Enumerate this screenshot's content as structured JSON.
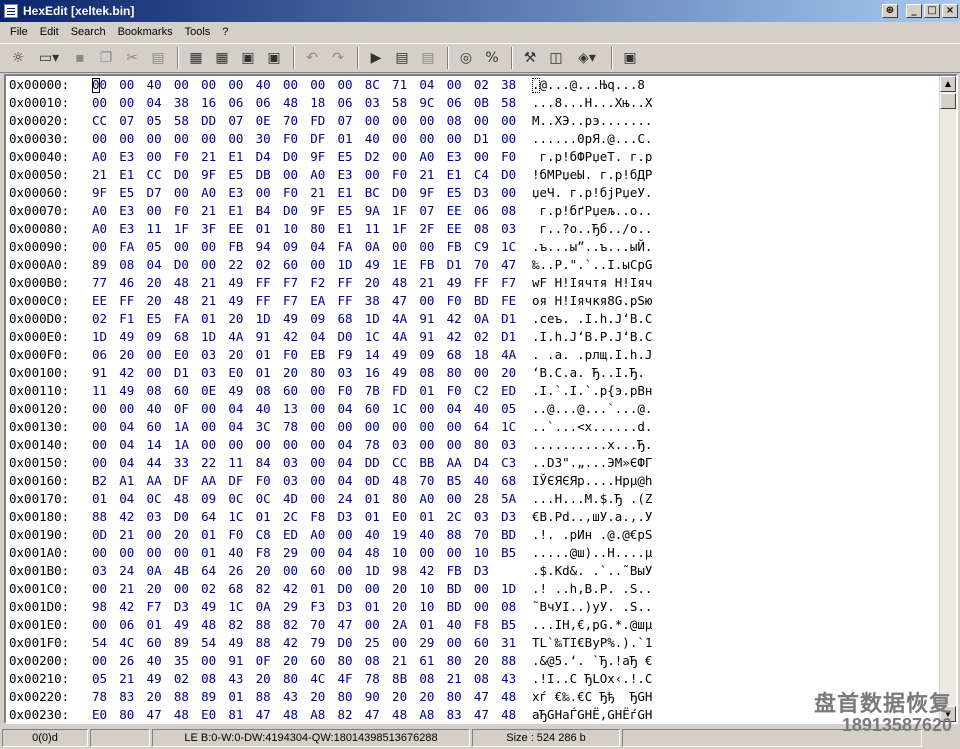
{
  "window": {
    "title": "HexEdit [xeltek.bin]"
  },
  "menu": [
    "File",
    "Edit",
    "Search",
    "Bookmarks",
    "Tools",
    "?"
  ],
  "hex_rows": [
    {
      "addr": "0x00000:",
      "hex": "00 00 40 00 00 00 40 00 00 00 8C 71 04 00 02 38",
      "ascii": ".@...@...Њq...8"
    },
    {
      "addr": "0x00010:",
      "hex": "00 00 04 38 16 06 06 48 18 06 03 58 9C 06 0B 58",
      "ascii": "...8...H...Xњ..X"
    },
    {
      "addr": "0x00020:",
      "hex": "CC 07 05 58 DD 07 0E 70 FD 07 00 00 00 08 00 00",
      "ascii": "М..XЭ..pэ......."
    },
    {
      "addr": "0x00030:",
      "hex": "00 00 00 00 00 00 30 F0 DF 01 40 00 00 00 D1 00",
      "ascii": "......0рЯ.@...С."
    },
    {
      "addr": "0x00040:",
      "hex": "A0 E3 00 F0 21 E1 D4 D0 9F E5 D2 00 A0 E3 00 F0",
      "ascii": " г.р!бФРџеТ. г.р"
    },
    {
      "addr": "0x00050:",
      "hex": "21 E1 CC D0 9F E5 DB 00 A0 E3 00 F0 21 E1 C4 D0",
      "ascii": "!бМРџеЫ. г.р!бДР"
    },
    {
      "addr": "0x00060:",
      "hex": "9F E5 D7 00 A0 E3 00 F0 21 E1 BC D0 9F E5 D3 00",
      "ascii": "џеЧ. г.р!бјРџеУ."
    },
    {
      "addr": "0x00070:",
      "hex": "A0 E3 00 F0 21 E1 B4 D0 9F E5 9A 1F 07 EE 06 08",
      "ascii": " г.р!бґРџељ..о.."
    },
    {
      "addr": "0x00080:",
      "hex": "A0 E3 11 1F 3F EE 01 10 80 E1 11 1F 2F EE 08 03",
      "ascii": " г..?о..Ђб../о.."
    },
    {
      "addr": "0x00090:",
      "hex": "00 FA 05 00 00 FB 94 09 04 FA 0A 00 00 FB C9 1C",
      "ascii": ".ъ...ы”..ъ...ыЙ."
    },
    {
      "addr": "0x000A0:",
      "hex": "89 08 04 D0 00 22 02 60 00 1D 49 1E FB D1 70 47",
      "ascii": "‰..Р.\".`..I.ыСpG"
    },
    {
      "addr": "0x000B0:",
      "hex": "77 46 20 48 21 49 FF F7 F2 FF 20 48 21 49 FF F7",
      "ascii": "wF H!Іячтя H!Іяч"
    },
    {
      "addr": "0x000C0:",
      "hex": "EE FF 20 48 21 49 FF F7 EA FF 38 47 00 F0 BD FE",
      "ascii": "оя H!Іячкя8G.pЅю"
    },
    {
      "addr": "0x000D0:",
      "hex": "02 F1 E5 FA 01 20 1D 49 09 68 1D 4A 91 42 0A D1",
      "ascii": ".сеъ. .I.h.J‘B.С"
    },
    {
      "addr": "0x000E0:",
      "hex": "1D 49 09 68 1D 4A 91 42 04 D0 1C 4A 91 42 02 D1",
      "ascii": ".I.h.J‘B.Р.J‘B.С"
    },
    {
      "addr": "0x000F0:",
      "hex": "06 20 00 E0 03 20 01 F0 EB F9 14 49 09 68 18 4A",
      "ascii": ". .а. .рлщ.I.h.J"
    },
    {
      "addr": "0x00100:",
      "hex": "91 42 00 D1 03 E0 01 20 80 03 16 49 08 80 00 20",
      "ascii": "‘B.С.а. Ђ..I.Ђ. "
    },
    {
      "addr": "0x00110:",
      "hex": "11 49 08 60 0E 49 08 60 00 F0 7B FD 01 F0 C2 ED",
      "ascii": ".I.`.I.`.р{э.рВн"
    },
    {
      "addr": "0x00120:",
      "hex": "00 00 40 0F 00 04 40 13 00 04 60 1C 00 04 40 05",
      "ascii": "..@...@...`...@."
    },
    {
      "addr": "0x00130:",
      "hex": "00 04 60 1A 00 04 3C 78 00 00 00 00 00 00 64 1C",
      "ascii": "..`...<x......d."
    },
    {
      "addr": "0x00140:",
      "hex": "00 04 14 1A 00 00 00 00 00 04 78 03 00 00 80 03",
      "ascii": "..........x...Ђ."
    },
    {
      "addr": "0x00150:",
      "hex": "00 04 44 33 22 11 84 03 00 04 DD CC BB AA D4 C3",
      "ascii": "..D3\".„...ЭМ»ЄФГ"
    },
    {
      "addr": "0x00160:",
      "hex": "B2 A1 AA DF AA DF F0 03 00 04 0D 48 70 B5 40 68",
      "ascii": "ІЎЄЯЄЯр....Hpµ@h"
    },
    {
      "addr": "0x00170:",
      "hex": "01 04 0C 48 09 0C 0C 4D 00 24 01 80 A0 00 28 5A",
      "ascii": "...H...M.$.Ђ .(Z"
    },
    {
      "addr": "0x00180:",
      "hex": "88 42 03 D0 64 1C 01 2C F8 D3 01 E0 01 2C 03 D3",
      "ascii": "€B.Рd..,шУ.а.,.У"
    },
    {
      "addr": "0x00190:",
      "hex": "0D 21 00 20 01 F0 C8 ED A0 00 40 19 40 88 70 BD",
      "ascii": ".!. .рИн .@.@€pЅ"
    },
    {
      "addr": "0x001A0:",
      "hex": "00 00 00 00 01 40 F8 29 00 04 48 10 00 00 10 B5",
      "ascii": ".....@ш)..H....µ"
    },
    {
      "addr": "0x001B0:",
      "hex": "03 24 0A 4B 64 26 20 00 60 00 1D 98 42 FB D3",
      "ascii": ".$.Kd&. .`..˜BыУ"
    },
    {
      "addr": "0x001C0:",
      "hex": "00 21 20 00 02 68 82 42 01 D0 00 20 10 BD 00 1D",
      "ascii": ".! ..h‚B.Р. .Ѕ.."
    },
    {
      "addr": "0x001D0:",
      "hex": "98 42 F7 D3 49 1C 0A 29 F3 D3 01 20 10 BD 00 08",
      "ascii": "˜BчУI..)уУ. .Ѕ.."
    },
    {
      "addr": "0x001E0:",
      "hex": "00 06 01 49 48 82 88 82 70 47 00 2A 01 40 F8 B5",
      "ascii": "...IH‚€‚pG.*.@шµ"
    },
    {
      "addr": "0x001F0:",
      "hex": "54 4C 60 89 54 49 88 42 79 D0 25 00 29 00 60 31",
      "ascii": "TL`‰TI€ByР%.).`1"
    },
    {
      "addr": "0x00200:",
      "hex": "00 26 40 35 00 91 0F 20 60 80 08 21 61 80 20 88",
      "ascii": ".&@5.‘. `Ђ.!aЂ €"
    },
    {
      "addr": "0x00210:",
      "hex": "05 21 49 02 08 43 20 80 4C 4F 78 8B 08 21 08 43",
      "ascii": ".!I..C ЂLOx‹.!.C"
    },
    {
      "addr": "0x00220:",
      "hex": "78 83 20 88 89 01 88 43 20 80 90 20 20 80 47 48",
      "ascii": "xѓ €‰.€C Ђђ  ЂGH"
    },
    {
      "addr": "0x00230:",
      "hex": "E0 80 47 48 E0 81 47 48 A8 82 47 48 A8 83 47 48",
      "ascii": "аЂGHаЃGHЁ‚GHЁѓGH"
    }
  ],
  "status": {
    "position": "0(0)d",
    "value": "LE B:0-W:0-DW:4194304-QW:18014398513676288",
    "size": "Size : 524 286 b"
  },
  "watermark": {
    "title": "盘首数据恢复",
    "phone": "18913587620"
  }
}
